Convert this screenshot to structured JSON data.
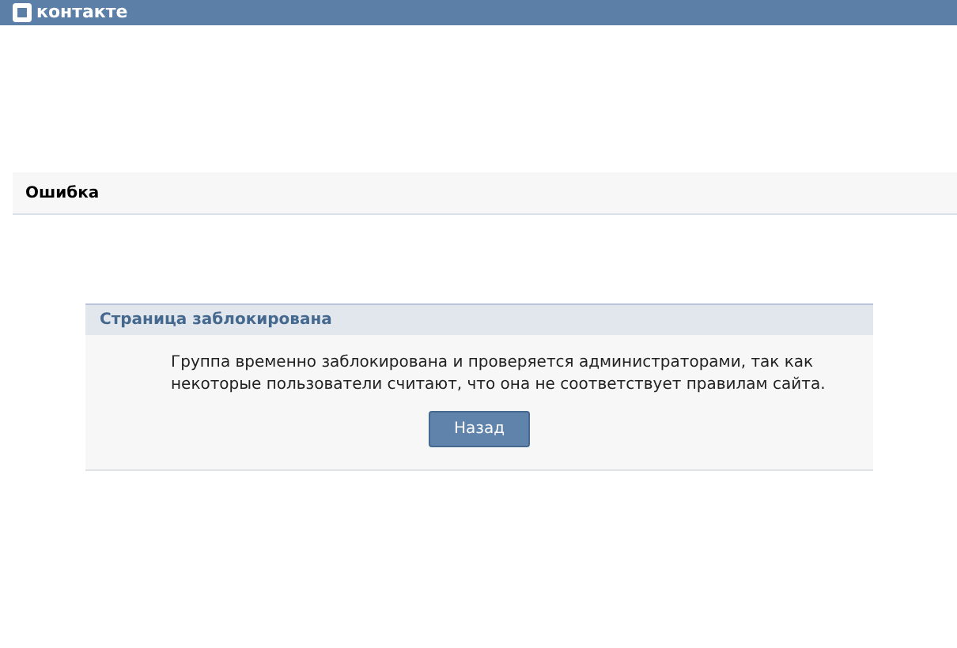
{
  "header": {
    "logo": "контакте"
  },
  "page_title": "Ошибка",
  "message_box": {
    "title": "Страница заблокирована",
    "text": "Группа временно заблокирована и проверяется администраторами, так как некоторые пользователи считают, что она не соответствует правилам сайта.",
    "button": "Назад"
  }
}
